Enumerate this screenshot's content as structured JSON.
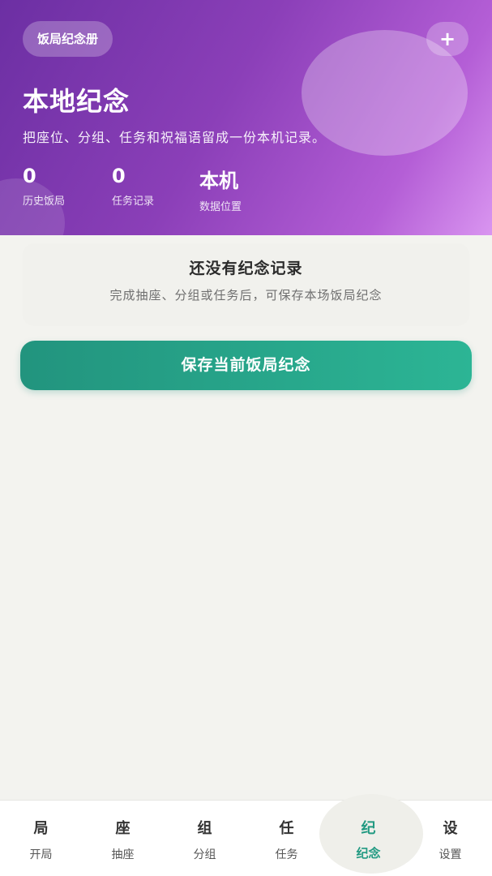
{
  "hero": {
    "chip_label": "饭局纪念册",
    "add_icon": "plus-icon",
    "add_glyph": "+",
    "title": "本地纪念",
    "subtitle": "把座位、分组、任务和祝福语留成一份本机记录。",
    "stats": [
      {
        "value": "0",
        "label": "历史饭局"
      },
      {
        "value": "0",
        "label": "任务记录"
      },
      {
        "value": "本机",
        "label": "数据位置"
      }
    ],
    "colors": {
      "gradient_start": "#6c2fa3",
      "gradient_end": "#d995f0"
    }
  },
  "empty_state": {
    "title": "还没有纪念记录",
    "subtitle": "完成抽座、分组或任务后，可保存本场饭局纪念"
  },
  "save_button": {
    "label": "保存当前饭局纪念",
    "color": "#22947e"
  },
  "tabbar": {
    "active_color": "#229a82",
    "tabs": [
      {
        "glyph": "局",
        "label": "开局"
      },
      {
        "glyph": "座",
        "label": "抽座"
      },
      {
        "glyph": "组",
        "label": "分组"
      },
      {
        "glyph": "任",
        "label": "任务"
      },
      {
        "glyph": "纪",
        "label": "纪念",
        "active": true
      },
      {
        "glyph": "设",
        "label": "设置"
      }
    ]
  }
}
